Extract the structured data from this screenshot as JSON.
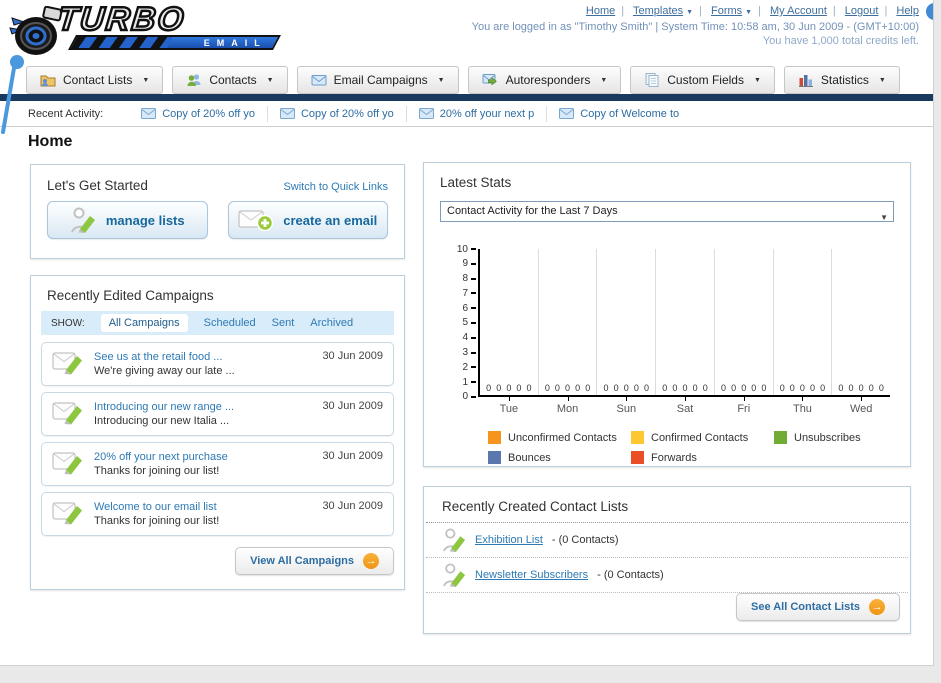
{
  "header": {
    "logo": {
      "name": "TURBO",
      "tagline": "EMAIL"
    },
    "links": [
      "Home",
      "Templates",
      "Forms",
      "My Account",
      "Logout",
      "Help"
    ],
    "login_info": "You are logged in as \"Timothy Smith\" | System Time: 10:58 am, 30 Jun 2009 - (GMT+10:00)",
    "credits_info": "You have 1,000 total credits left."
  },
  "tabs": [
    {
      "label": "Contact Lists",
      "icon": "folder-contact-icon"
    },
    {
      "label": "Contacts",
      "icon": "people-icon"
    },
    {
      "label": "Email Campaigns",
      "icon": "envelope-icon"
    },
    {
      "label": "Autoresponders",
      "icon": "envelope-arrow-icon"
    },
    {
      "label": "Custom Fields",
      "icon": "pages-icon"
    },
    {
      "label": "Statistics",
      "icon": "bar-chart-icon"
    }
  ],
  "recent_activity": {
    "label": "Recent Activity:",
    "items": [
      "Copy of 20% off yo",
      "Copy of 20% off yo",
      "20% off your next p",
      "Copy of Welcome to"
    ]
  },
  "page_title": "Home",
  "get_started": {
    "title": "Let's Get Started",
    "switch_link": "Switch to Quick Links",
    "manage_button": "manage lists",
    "create_button": "create an email"
  },
  "campaigns": {
    "title": "Recently Edited Campaigns",
    "show_label": "SHOW:",
    "filters": [
      "All Campaigns",
      "Scheduled",
      "Sent",
      "Archived"
    ],
    "active_filter": "All Campaigns",
    "items": [
      {
        "title": "See us at the retail food ...",
        "subtitle": "We're giving away our late ...",
        "date": "30 Jun 2009"
      },
      {
        "title": "Introducing our new range ...",
        "subtitle": "Introducing our new Italia ...",
        "date": "30 Jun 2009"
      },
      {
        "title": "20% off your next purchase",
        "subtitle": "Thanks for joining our list!",
        "date": "30 Jun 2009"
      },
      {
        "title": "Welcome to our email list",
        "subtitle": "Thanks for joining our list!",
        "date": "30 Jun 2009"
      }
    ],
    "view_all_label": "View All Campaigns"
  },
  "stats": {
    "title": "Latest Stats",
    "dropdown_value": "Contact Activity for the Last 7 Days",
    "chart_data": {
      "type": "bar",
      "categories": [
        "Tue",
        "Mon",
        "Sun",
        "Sat",
        "Fri",
        "Thu",
        "Wed"
      ],
      "series": [
        {
          "name": "Unconfirmed Contacts",
          "color": "#F7941E",
          "values": [
            0,
            0,
            0,
            0,
            0,
            0,
            0
          ]
        },
        {
          "name": "Confirmed Contacts",
          "color": "#FDC72F",
          "values": [
            0,
            0,
            0,
            0,
            0,
            0,
            0
          ]
        },
        {
          "name": "Unsubscribes",
          "color": "#71AD34",
          "values": [
            0,
            0,
            0,
            0,
            0,
            0,
            0
          ]
        },
        {
          "name": "Bounces",
          "color": "#5B78AE",
          "values": [
            0,
            0,
            0,
            0,
            0,
            0,
            0
          ]
        },
        {
          "name": "Forwards",
          "color": "#E94E25",
          "values": [
            0,
            0,
            0,
            0,
            0,
            0,
            0
          ]
        }
      ],
      "ylim": [
        0,
        10
      ],
      "yticks": [
        0,
        1,
        2,
        3,
        4,
        5,
        6,
        7,
        8,
        9,
        10
      ],
      "grid": "vertical-between-groups",
      "legend_position": "bottom",
      "value_labels_shown": true
    }
  },
  "contact_lists": {
    "title": "Recently Created Contact Lists",
    "items": [
      {
        "name": "Exhibition List",
        "suffix": "- (0 Contacts)"
      },
      {
        "name": "Newsletter Subscribers",
        "suffix": "- (0 Contacts)"
      }
    ],
    "see_all_label": "See All Contact Lists"
  },
  "icons": {
    "forward_arrow": "→",
    "dropdown_arrow": "▼"
  }
}
